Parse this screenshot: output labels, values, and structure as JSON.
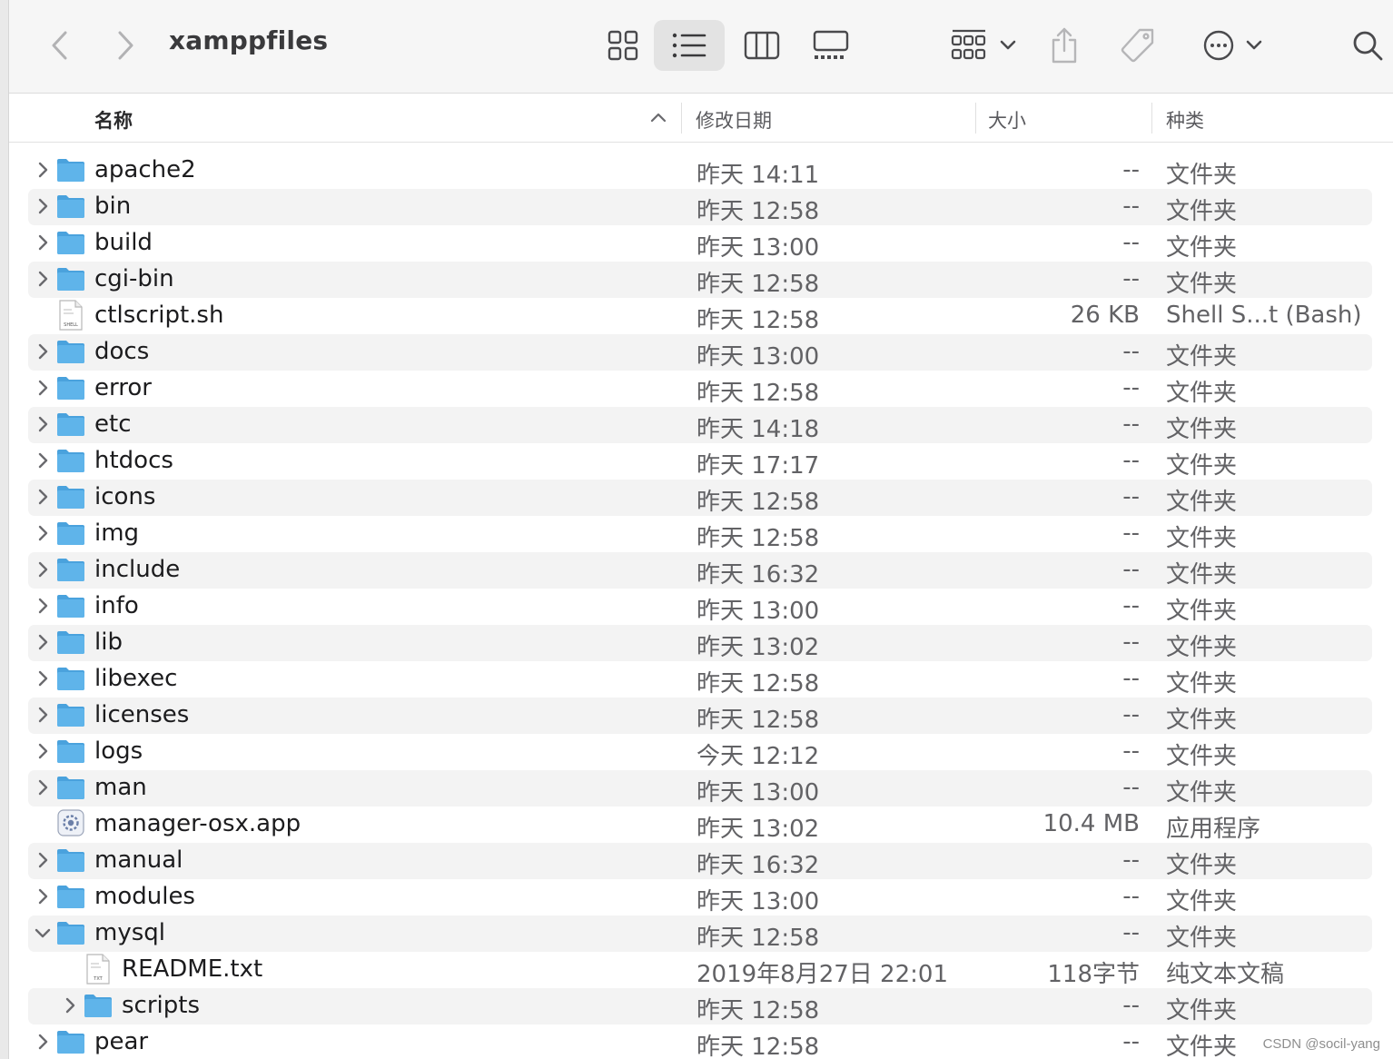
{
  "window": {
    "title": "xamppfiles"
  },
  "columns": {
    "name": "名称",
    "date": "修改日期",
    "size": "大小",
    "kind": "种类"
  },
  "rows": [
    {
      "name": "apache2",
      "date": "昨天 14:11",
      "size": "--",
      "kind": "文件夹",
      "type": "folder",
      "level": 0,
      "expanded": false
    },
    {
      "name": "bin",
      "date": "昨天 12:58",
      "size": "--",
      "kind": "文件夹",
      "type": "folder",
      "level": 0,
      "expanded": false
    },
    {
      "name": "build",
      "date": "昨天 13:00",
      "size": "--",
      "kind": "文件夹",
      "type": "folder",
      "level": 0,
      "expanded": false
    },
    {
      "name": "cgi-bin",
      "date": "昨天 12:58",
      "size": "--",
      "kind": "文件夹",
      "type": "folder",
      "level": 0,
      "expanded": false
    },
    {
      "name": "ctlscript.sh",
      "date": "昨天 12:58",
      "size": "26 KB",
      "kind": "Shell S...t (Bash)",
      "type": "shell",
      "level": 0
    },
    {
      "name": "docs",
      "date": "昨天 13:00",
      "size": "--",
      "kind": "文件夹",
      "type": "folder",
      "level": 0,
      "expanded": false
    },
    {
      "name": "error",
      "date": "昨天 12:58",
      "size": "--",
      "kind": "文件夹",
      "type": "folder",
      "level": 0,
      "expanded": false
    },
    {
      "name": "etc",
      "date": "昨天 14:18",
      "size": "--",
      "kind": "文件夹",
      "type": "folder",
      "level": 0,
      "expanded": false
    },
    {
      "name": "htdocs",
      "date": "昨天 17:17",
      "size": "--",
      "kind": "文件夹",
      "type": "folder",
      "level": 0,
      "expanded": false
    },
    {
      "name": "icons",
      "date": "昨天 12:58",
      "size": "--",
      "kind": "文件夹",
      "type": "folder",
      "level": 0,
      "expanded": false
    },
    {
      "name": "img",
      "date": "昨天 12:58",
      "size": "--",
      "kind": "文件夹",
      "type": "folder",
      "level": 0,
      "expanded": false
    },
    {
      "name": "include",
      "date": "昨天 16:32",
      "size": "--",
      "kind": "文件夹",
      "type": "folder",
      "level": 0,
      "expanded": false
    },
    {
      "name": "info",
      "date": "昨天 13:00",
      "size": "--",
      "kind": "文件夹",
      "type": "folder",
      "level": 0,
      "expanded": false
    },
    {
      "name": "lib",
      "date": "昨天 13:02",
      "size": "--",
      "kind": "文件夹",
      "type": "folder",
      "level": 0,
      "expanded": false
    },
    {
      "name": "libexec",
      "date": "昨天 12:58",
      "size": "--",
      "kind": "文件夹",
      "type": "folder",
      "level": 0,
      "expanded": false
    },
    {
      "name": "licenses",
      "date": "昨天 12:58",
      "size": "--",
      "kind": "文件夹",
      "type": "folder",
      "level": 0,
      "expanded": false
    },
    {
      "name": "logs",
      "date": "今天 12:12",
      "size": "--",
      "kind": "文件夹",
      "type": "folder",
      "level": 0,
      "expanded": false
    },
    {
      "name": "man",
      "date": "昨天 13:00",
      "size": "--",
      "kind": "文件夹",
      "type": "folder",
      "level": 0,
      "expanded": false
    },
    {
      "name": "manager-osx.app",
      "date": "昨天 13:02",
      "size": "10.4 MB",
      "kind": "应用程序",
      "type": "app",
      "level": 0
    },
    {
      "name": "manual",
      "date": "昨天 16:32",
      "size": "--",
      "kind": "文件夹",
      "type": "folder",
      "level": 0,
      "expanded": false
    },
    {
      "name": "modules",
      "date": "昨天 13:00",
      "size": "--",
      "kind": "文件夹",
      "type": "folder",
      "level": 0,
      "expanded": false
    },
    {
      "name": "mysql",
      "date": "昨天 12:58",
      "size": "--",
      "kind": "文件夹",
      "type": "folder",
      "level": 0,
      "expanded": true
    },
    {
      "name": "README.txt",
      "date": "2019年8月27日 22:01",
      "size": "118字节",
      "kind": "纯文本文稿",
      "type": "txt",
      "level": 1
    },
    {
      "name": "scripts",
      "date": "昨天 12:58",
      "size": "--",
      "kind": "文件夹",
      "type": "folder",
      "level": 1,
      "expanded": false
    },
    {
      "name": "pear",
      "date": "昨天 12:58",
      "size": "--",
      "kind": "文件夹",
      "type": "folder",
      "level": 0,
      "expanded": false
    }
  ],
  "watermark": "CSDN @socil-yang",
  "colors": {
    "folder": "#5fb4ea",
    "folder_tab": "#4aa2dd",
    "selected_view_bg": "#e3e3e3"
  }
}
